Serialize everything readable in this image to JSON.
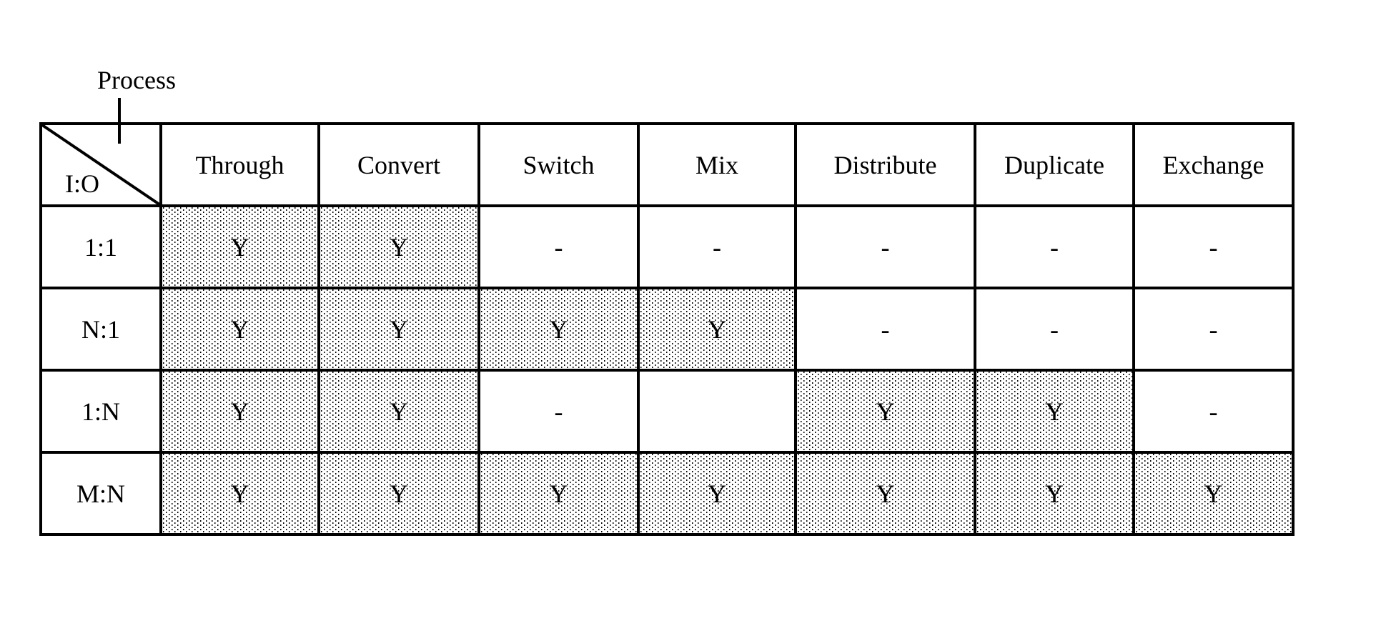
{
  "diagram": {
    "axis_label_top": "Process",
    "axis_label_corner": "I:O",
    "columns": [
      "Through",
      "Convert",
      "Switch",
      "Mix",
      "Distribute",
      "Duplicate",
      "Exchange"
    ],
    "rows": [
      {
        "label": "1:1",
        "cells": [
          {
            "value": "Y",
            "shaded": true
          },
          {
            "value": "Y",
            "shaded": true
          },
          {
            "value": "-",
            "shaded": false
          },
          {
            "value": "-",
            "shaded": false
          },
          {
            "value": "-",
            "shaded": false
          },
          {
            "value": "-",
            "shaded": false
          },
          {
            "value": "-",
            "shaded": false
          }
        ]
      },
      {
        "label": "N:1",
        "cells": [
          {
            "value": "Y",
            "shaded": true
          },
          {
            "value": "Y",
            "shaded": true
          },
          {
            "value": "Y",
            "shaded": true
          },
          {
            "value": "Y",
            "shaded": true
          },
          {
            "value": "-",
            "shaded": false
          },
          {
            "value": "-",
            "shaded": false
          },
          {
            "value": "-",
            "shaded": false
          }
        ]
      },
      {
        "label": "1:N",
        "cells": [
          {
            "value": "Y",
            "shaded": true
          },
          {
            "value": "Y",
            "shaded": true
          },
          {
            "value": "-",
            "shaded": false
          },
          {
            "value": "",
            "shaded": false
          },
          {
            "value": "Y",
            "shaded": true
          },
          {
            "value": "Y",
            "shaded": true
          },
          {
            "value": "-",
            "shaded": false
          }
        ]
      },
      {
        "label": "M:N",
        "cells": [
          {
            "value": "Y",
            "shaded": true
          },
          {
            "value": "Y",
            "shaded": true
          },
          {
            "value": "Y",
            "shaded": true
          },
          {
            "value": "Y",
            "shaded": true
          },
          {
            "value": "Y",
            "shaded": true
          },
          {
            "value": "Y",
            "shaded": true
          },
          {
            "value": "Y",
            "shaded": true
          }
        ]
      }
    ],
    "colors": {
      "line": "#000000",
      "background": "#ffffff",
      "shade_dot": "#000000"
    }
  }
}
